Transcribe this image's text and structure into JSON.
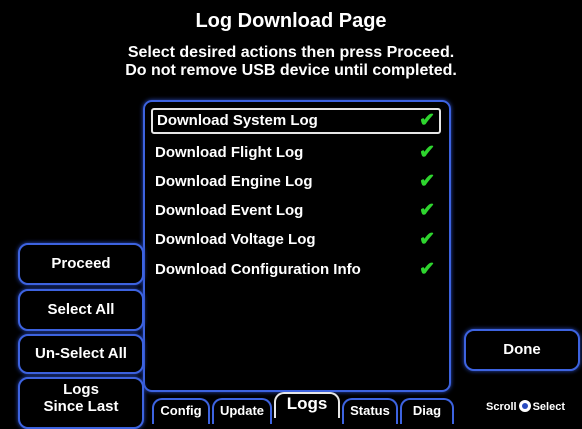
{
  "header": {
    "title": "Log Download Page",
    "line1": "Select desired actions then press Proceed.",
    "line2": "Do not remove USB device until completed."
  },
  "log_list": {
    "items": [
      {
        "label": "Download System Log",
        "checked": true,
        "selected": true
      },
      {
        "label": "Download Flight Log",
        "checked": true,
        "selected": false
      },
      {
        "label": "Download Engine Log",
        "checked": true,
        "selected": false
      },
      {
        "label": "Download Event Log",
        "checked": true,
        "selected": false
      },
      {
        "label": "Download Voltage Log",
        "checked": true,
        "selected": false
      },
      {
        "label": "Download Configuration Info",
        "checked": true,
        "selected": false
      }
    ],
    "check_glyph": "✔",
    "check_color": "#2ed52e"
  },
  "buttons": {
    "proceed": "Proceed",
    "select_all": "Select All",
    "unselect_all": "Un-Select All",
    "logs_since_last_line1": "Logs",
    "logs_since_last_line2": "Since Last",
    "done": "Done"
  },
  "tabs": {
    "config": "Config",
    "update": "Update",
    "logs": "Logs",
    "status": "Status",
    "diag": "Diag",
    "active": "Logs"
  },
  "knob_hint": {
    "scroll": "Scroll",
    "select": "Select",
    "icon": "knob-icon"
  },
  "colors": {
    "accent": "#3d63e0",
    "background": "#000000",
    "text": "#ffffff"
  }
}
